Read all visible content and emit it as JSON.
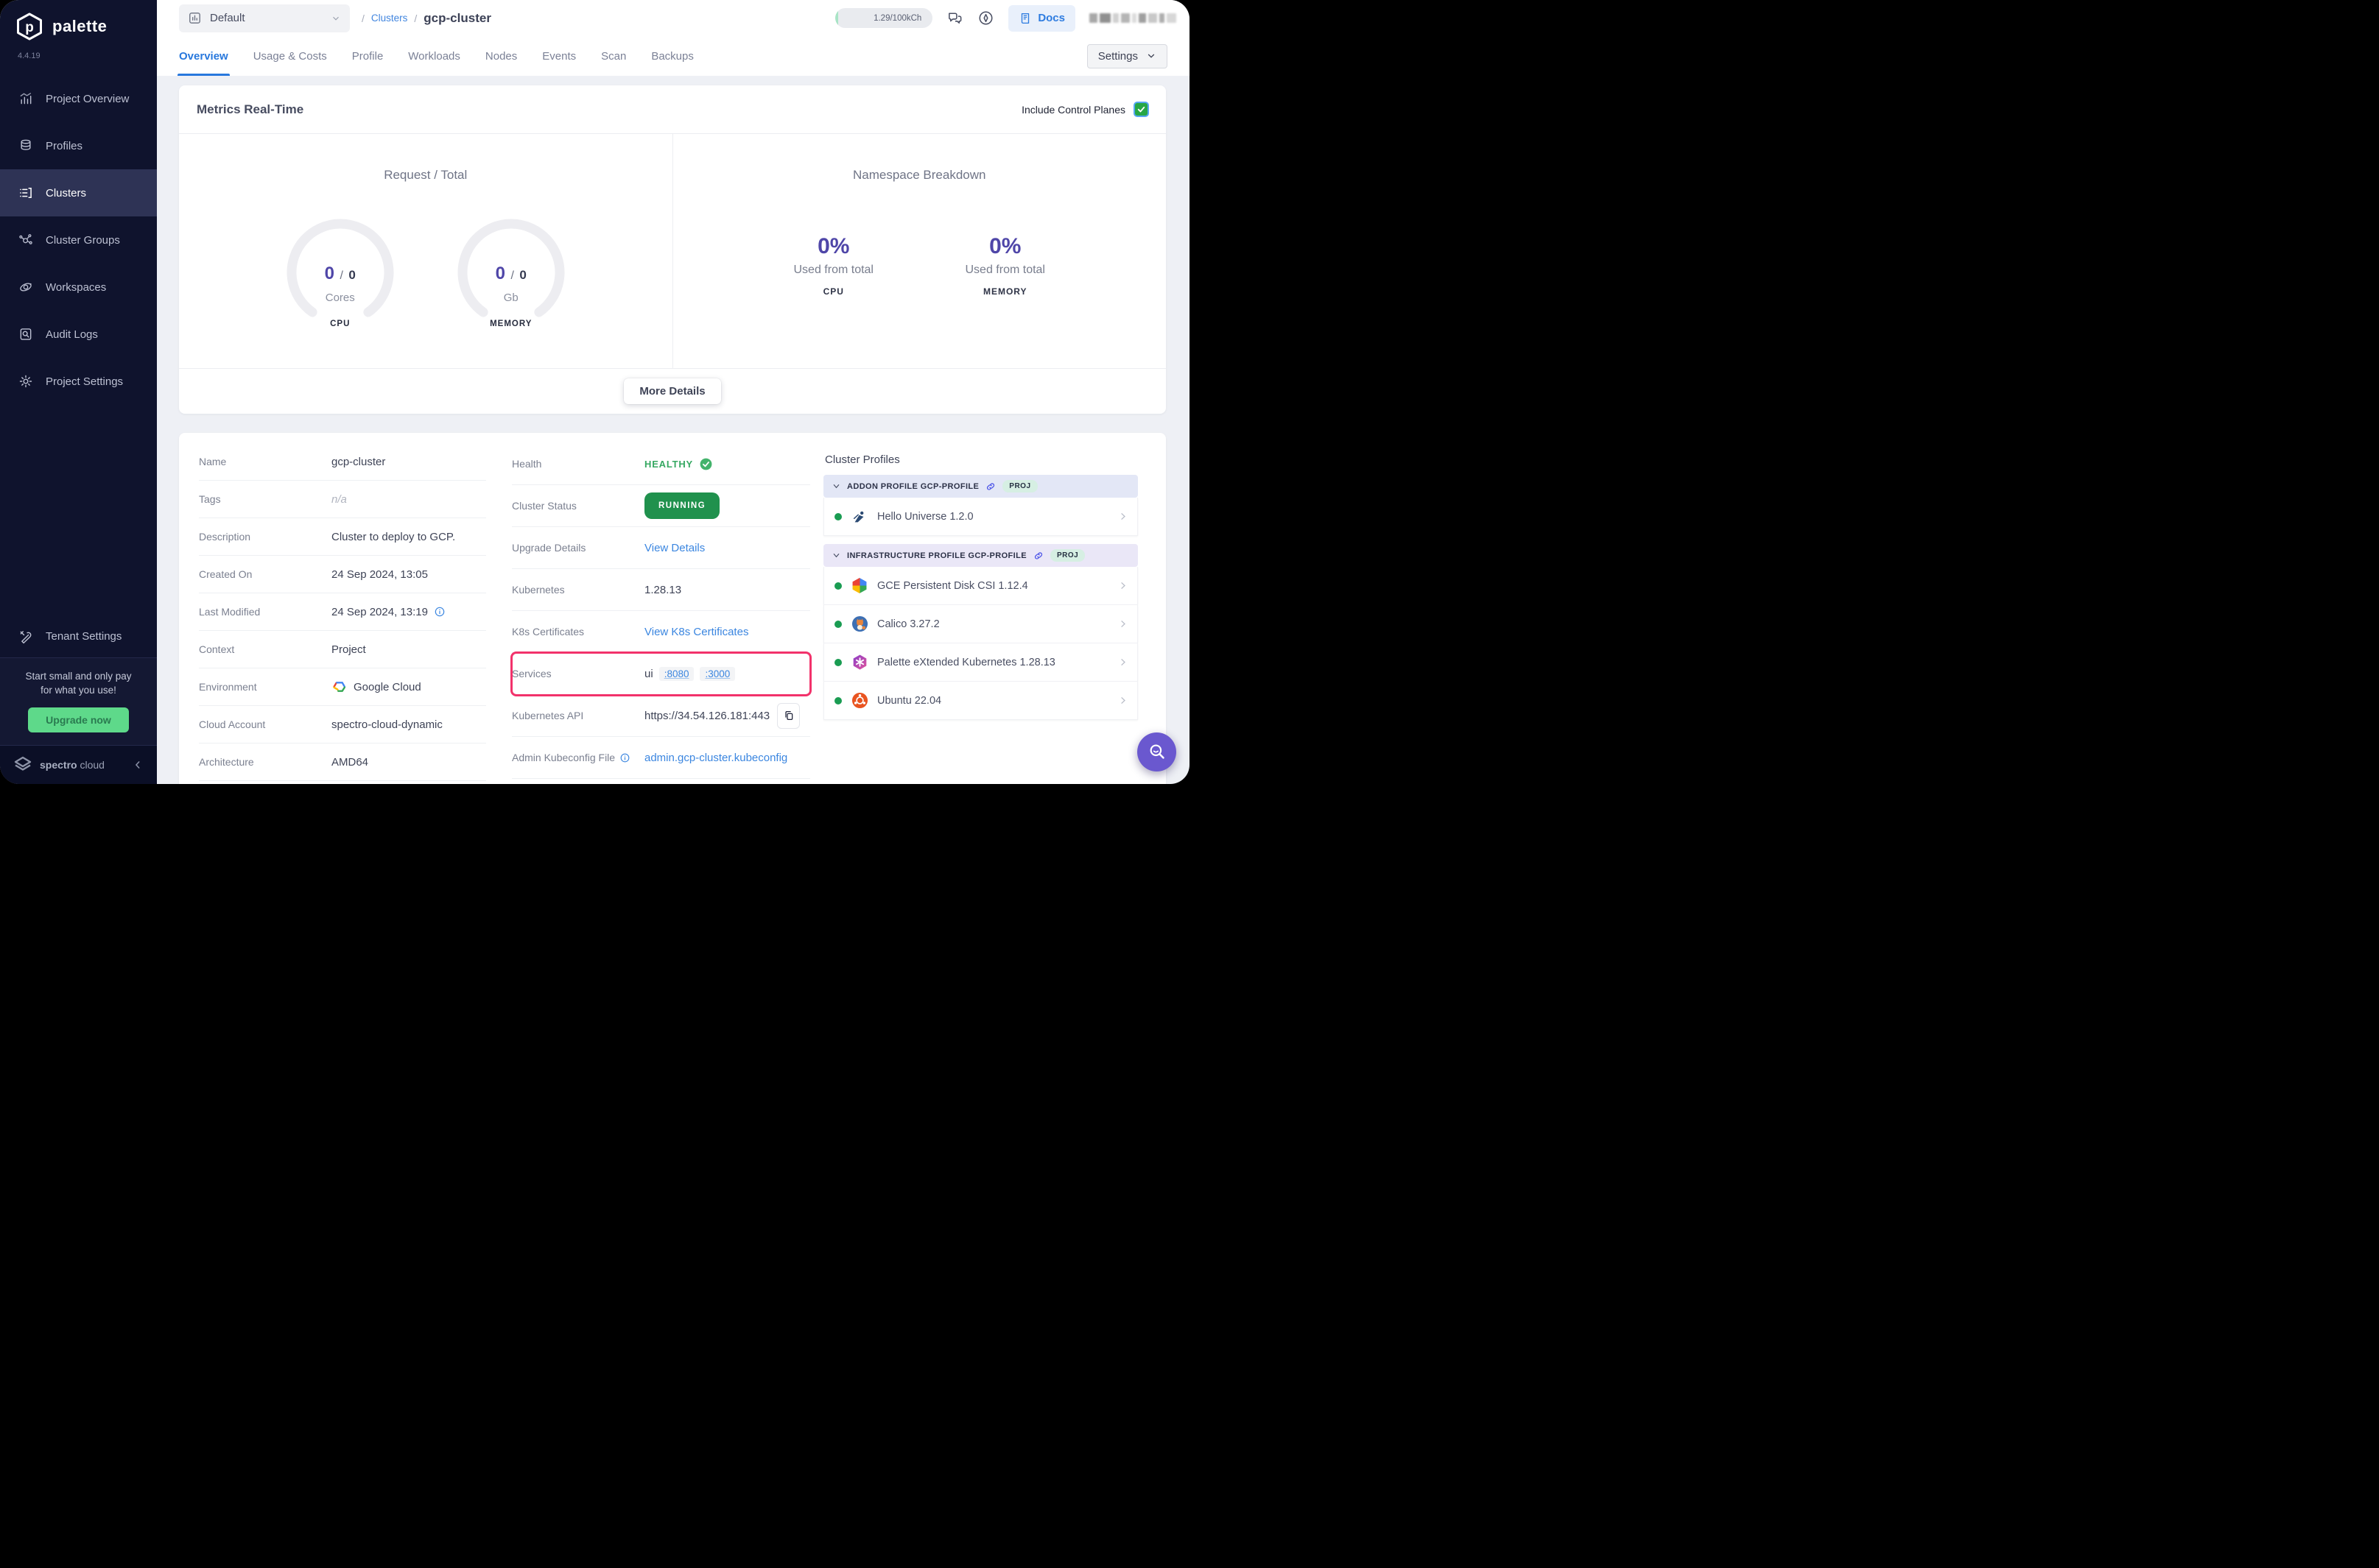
{
  "app": {
    "brand": "palette",
    "version": "4.4.19"
  },
  "sidebar": {
    "items": [
      {
        "label": "Project Overview"
      },
      {
        "label": "Profiles"
      },
      {
        "label": "Clusters"
      },
      {
        "label": "Cluster Groups"
      },
      {
        "label": "Workspaces"
      },
      {
        "label": "Audit Logs"
      },
      {
        "label": "Project Settings"
      }
    ],
    "tenant_settings": "Tenant Settings",
    "promo_line1": "Start small and only pay",
    "promo_line2": "for what you use!",
    "promo_cta": "Upgrade now",
    "footer_brand_1": "spectro",
    "footer_brand_2": "cloud"
  },
  "topbar": {
    "project_selector": "Default",
    "breadcrumb_sep": "/",
    "breadcrumb_link": "Clusters",
    "page_title": "gcp-cluster",
    "usage_badge": "1.29/100kCh",
    "docs": "Docs",
    "settings": "Settings"
  },
  "tabs": [
    "Overview",
    "Usage & Costs",
    "Profile",
    "Workloads",
    "Nodes",
    "Events",
    "Scan",
    "Backups"
  ],
  "metrics": {
    "title": "Metrics Real-Time",
    "include_toggle": "Include Control Planes",
    "left_title": "Request / Total",
    "gauges": [
      {
        "request": "0",
        "sep": "/",
        "total": "0",
        "unit": "Cores",
        "label": "CPU"
      },
      {
        "request": "0",
        "sep": "/",
        "total": "0",
        "unit": "Gb",
        "label": "MEMORY"
      }
    ],
    "right_title": "Namespace Breakdown",
    "stats": [
      {
        "percent": "0%",
        "caption": "Used from total",
        "label": "CPU"
      },
      {
        "percent": "0%",
        "caption": "Used from total",
        "label": "MEMORY"
      }
    ],
    "more_details": "More Details"
  },
  "details": {
    "rows_left": [
      {
        "label": "Name",
        "value": "gcp-cluster"
      },
      {
        "label": "Tags",
        "value": "n/a"
      },
      {
        "label": "Description",
        "value": "Cluster to deploy to GCP."
      },
      {
        "label": "Created On",
        "value": "24 Sep 2024, 13:05"
      },
      {
        "label": "Last Modified",
        "value": "24 Sep 2024, 13:19"
      },
      {
        "label": "Context",
        "value": "Project"
      },
      {
        "label": "Environment",
        "value": "Google Cloud"
      },
      {
        "label": "Cloud Account",
        "value": "spectro-cloud-dynamic"
      },
      {
        "label": "Architecture",
        "value": "AMD64"
      }
    ],
    "rows_mid": [
      {
        "label": "Health",
        "value": "HEALTHY"
      },
      {
        "label": "Cluster Status",
        "value": "RUNNING"
      },
      {
        "label": "Upgrade Details",
        "value": "View Details"
      },
      {
        "label": "Kubernetes",
        "value": "1.28.13"
      },
      {
        "label": "K8s Certificates",
        "value": "View K8s Certificates"
      },
      {
        "label": "Services",
        "value": "ui",
        "port1": ":8080",
        "port2": ":3000"
      },
      {
        "label": "Kubernetes API",
        "value": "https://34.54.126.181:443"
      },
      {
        "label": "Admin Kubeconfig File",
        "value": "admin.gcp-cluster.kubeconfig"
      }
    ]
  },
  "profiles": {
    "title": "Cluster Profiles",
    "sections": [
      {
        "header": "ADDON PROFILE GCP-PROFILE",
        "badge": "PROJ",
        "items": [
          {
            "name": "Hello Universe 1.2.0"
          }
        ]
      },
      {
        "header": "INFRASTRUCTURE PROFILE GCP-PROFILE",
        "badge": "PROJ",
        "items": [
          {
            "name": "GCE Persistent Disk CSI 1.12.4"
          },
          {
            "name": "Calico 3.27.2"
          },
          {
            "name": "Palette eXtended Kubernetes 1.28.13"
          },
          {
            "name": "Ubuntu 22.04"
          }
        ]
      }
    ]
  },
  "colors": {
    "accent_blue": "#2e7ce0",
    "status_green": "#20914d",
    "stat_purple": "#4f46a8",
    "highlight_pink": "#f2326b",
    "fab_purple": "#6a58cf"
  }
}
